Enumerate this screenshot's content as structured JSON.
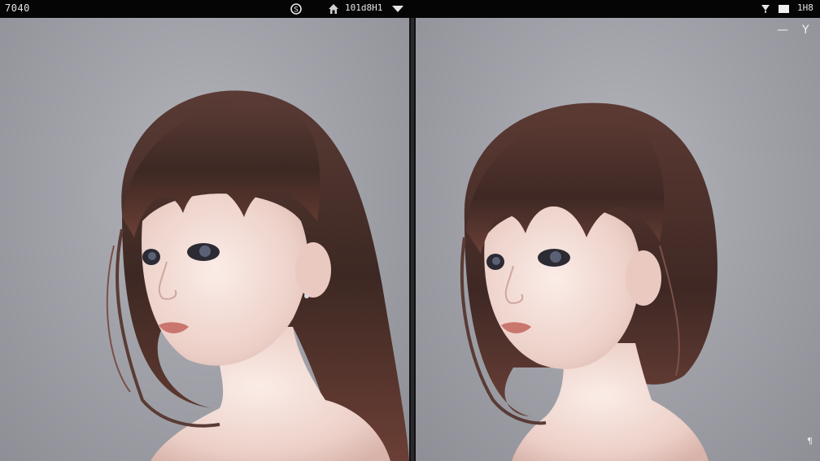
{
  "status_bar": {
    "time": "7040",
    "center_text": "101d8H1",
    "right_text": "1H8"
  },
  "window_controls": {
    "minimize_symbol": "—",
    "extra_symbol": "Y"
  },
  "panels": [
    {
      "id": "left",
      "subject": "portrait-long-hair"
    },
    {
      "id": "right",
      "subject": "portrait-bob-hair"
    }
  ],
  "corner_mark": "¶",
  "colors": {
    "topbar": "#050505",
    "background": "#a2a3aa",
    "divider": "#2a2a2e",
    "hair": "#4a2f2a",
    "skin": "#f1dcd6"
  },
  "icons": [
    "settings-icon",
    "home-icon",
    "wifi-dropdown-icon",
    "signal-icon",
    "battery-icon"
  ]
}
